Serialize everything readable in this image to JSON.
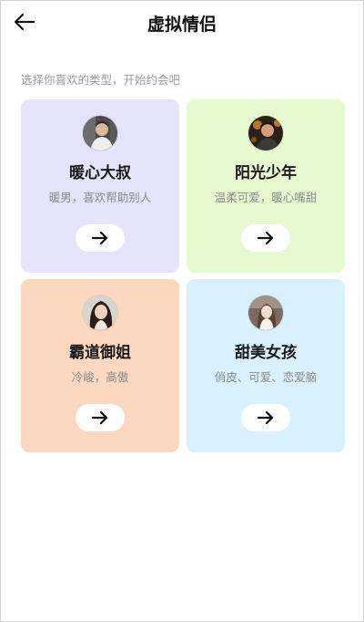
{
  "header": {
    "title": "虚拟情侣",
    "back_icon": "arrow-left-icon"
  },
  "subtitle": "选择你喜欢的类型，开始约会吧",
  "cards": [
    {
      "title": "暖心大叔",
      "description": "暖男，喜欢帮助别人",
      "background": "#e6e4fc",
      "button_icon": "arrow-right-icon"
    },
    {
      "title": "阳光少年",
      "description": "温柔可爱，暖心嘴甜",
      "background": "#e7f9cf",
      "button_icon": "arrow-right-icon"
    },
    {
      "title": "霸道御姐",
      "description": "冷峻，高傲",
      "background": "#fcd8c0",
      "button_icon": "arrow-right-icon"
    },
    {
      "title": "甜美女孩",
      "description": "俏皮、可爱、恋爱脑",
      "background": "#d9f1fc",
      "button_icon": "arrow-right-icon"
    }
  ]
}
